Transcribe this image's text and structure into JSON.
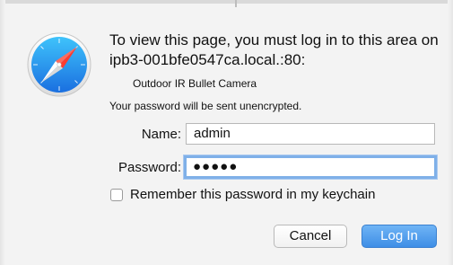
{
  "dialog": {
    "message_line1": "To view this page, you must log in to this area on",
    "message_line2": "ipb3-001bfe0547ca.local.:80:",
    "realm": "Outdoor IR Bullet Camera",
    "warning": "Your password will be sent unencrypted."
  },
  "form": {
    "name_label": "Name:",
    "name_value": "admin",
    "password_label": "Password:",
    "password_masked": "●●●●●",
    "remember_label": "Remember this password in my keychain",
    "remember_checked": false
  },
  "buttons": {
    "cancel_label": "Cancel",
    "login_label": "Log In"
  },
  "icons": {
    "app_icon": "safari-compass-icon"
  },
  "colors": {
    "accent": "#4a98ea",
    "focus_ring": "#7fb0e8",
    "background": "#f3f3f3"
  }
}
